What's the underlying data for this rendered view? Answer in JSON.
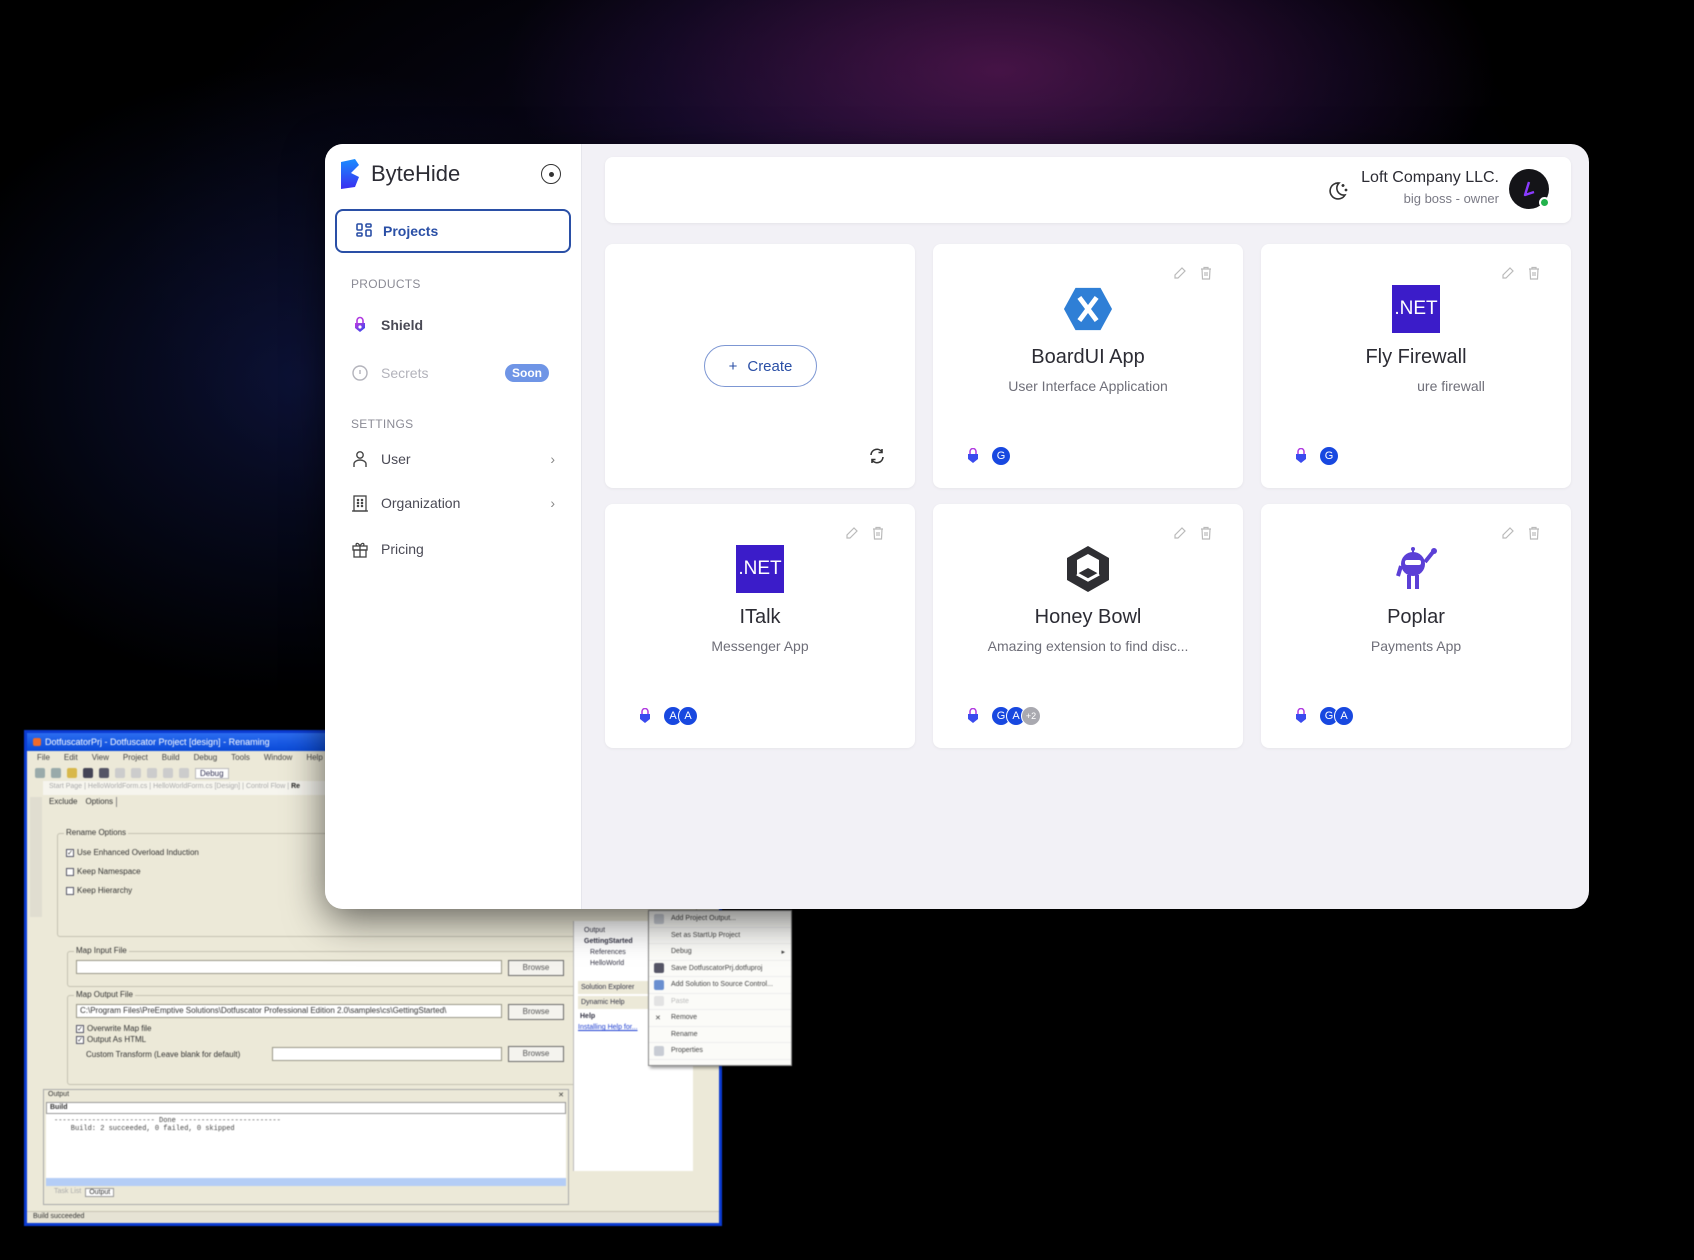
{
  "legacy_window": {
    "title": "DotfuscatorPrj - Dotfuscator Project [design] - Renaming",
    "menu": [
      "File",
      "Edit",
      "View",
      "Project",
      "Build",
      "Debug",
      "Tools",
      "Window",
      "Help"
    ],
    "config": "Debug",
    "doc_tabs": [
      "Start Page",
      "HelloWorldForm.cs",
      "HelloWorldForm.cs [Design]",
      "Control Flow",
      "Re"
    ],
    "sub_tabs": [
      "Exclude",
      "Options"
    ],
    "rename_options_label": "Rename Options",
    "rename_options": [
      {
        "label": "Use Enhanced Overload Induction",
        "checked": true
      },
      {
        "label": "Keep Namespace",
        "checked": false
      },
      {
        "label": "Keep Hierarchy",
        "checked": false
      }
    ],
    "map_input_label": "Map Input File",
    "map_input_value": "",
    "map_output_label": "Map Output File",
    "map_output_value": "C:\\Program Files\\PreEmptive Solutions\\Dotfuscator Professional Edition 2.0\\samples\\cs\\GettingStarted\\",
    "overwrite_map": {
      "label": "Overwrite Map file",
      "checked": true
    },
    "output_html": {
      "label": "Output As HTML",
      "checked": true
    },
    "custom_transform_label": "Custom Transform (Leave blank for default)",
    "browse_label": "Browse",
    "output_panel": {
      "title": "Output",
      "selector": "Build",
      "lines": [
        "------------------------ Done ------------------------",
        "",
        "    Build: 2 succeeded, 0 failed, 0 skipped"
      ],
      "tabs": [
        "Task List",
        "Output"
      ]
    },
    "solution_panel": {
      "items": [
        "Output",
        "GettingStarted",
        "References",
        "HelloWorld"
      ],
      "explorer_tab": "Solution Explorer",
      "dynamic_help": "Dynamic Help",
      "help_label": "Help",
      "help_link": "Installing Help for..."
    },
    "status": "Build succeeded",
    "context_menu": [
      {
        "label": "Add Project Output...",
        "disabled": false
      },
      {
        "label": "Set as StartUp Project",
        "disabled": false
      },
      {
        "label": "Debug",
        "disabled": false,
        "submenu": true
      },
      {
        "label": "Save DotfuscatorPrj.dotfuproj",
        "disabled": false
      },
      {
        "label": "Add Solution to Source Control...",
        "disabled": false
      },
      {
        "label": "Paste",
        "disabled": true
      },
      {
        "label": "Remove",
        "disabled": false
      },
      {
        "label": "Rename",
        "disabled": false
      },
      {
        "label": "Properties",
        "disabled": false
      }
    ]
  },
  "app": {
    "brand": "ByteHide",
    "nav_projects": "Projects",
    "products_label": "PRODUCTS",
    "products": [
      {
        "label": "Shield",
        "icon": "shield-lock-icon",
        "disabled": false
      },
      {
        "label": "Secrets",
        "icon": "info-circle-icon",
        "disabled": true,
        "badge": "Soon"
      }
    ],
    "settings_label": "SETTINGS",
    "settings": [
      {
        "label": "User",
        "icon": "user-icon",
        "chevron": true
      },
      {
        "label": "Organization",
        "icon": "building-icon",
        "chevron": true
      },
      {
        "label": "Pricing",
        "icon": "gift-icon",
        "chevron": false
      }
    ],
    "org_name": "Loft Company LLC.",
    "org_role": "big boss - owner",
    "avatar_status": "online",
    "create_label": "Create",
    "projects": [
      {
        "name": "BoardUI App",
        "description": "User Interface Application",
        "logo": "xamarin-icon",
        "members": [
          "G"
        ]
      },
      {
        "name": "Fly Firewall",
        "description": "ure firewall",
        "logo": "dotnet-icon",
        "logo_text": ".NET",
        "members": [
          "G"
        ]
      },
      {
        "name": "ITalk",
        "description": "Messenger App",
        "logo": "dotnet-icon",
        "logo_text": ".NET",
        "members": [
          "A",
          "A"
        ]
      },
      {
        "name": "Honey Bowl",
        "description": "Amazing extension to find disc...",
        "logo": "unity-icon",
        "members": [
          "G",
          "A"
        ],
        "extra_members": "+2"
      },
      {
        "name": "Poplar",
        "description": "Payments App",
        "logo": "dotnet-bot-icon",
        "members": [
          "G",
          "A"
        ]
      }
    ],
    "colors": {
      "accent": "#2a4fa6",
      "member_avatar": "#1848e0",
      "dotnet": "#3b1cc9",
      "xamarin": "#2f7fd6",
      "soon_badge": "#6f95e6",
      "online": "#22b24c"
    }
  }
}
